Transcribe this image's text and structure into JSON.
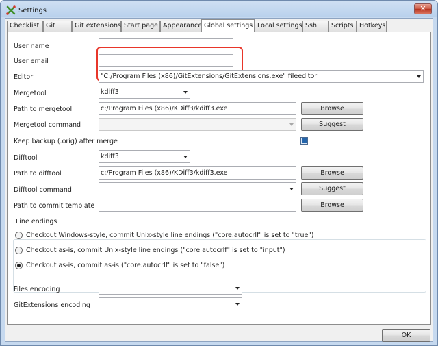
{
  "window": {
    "title": "Settings",
    "close_label": "✕"
  },
  "tabs": [
    {
      "label": "Checklist"
    },
    {
      "label": "Git"
    },
    {
      "label": "Git extensions"
    },
    {
      "label": "Start page"
    },
    {
      "label": "Appearance"
    },
    {
      "label": "Global settings"
    },
    {
      "label": "Local settings"
    },
    {
      "label": "Ssh"
    },
    {
      "label": "Scripts"
    },
    {
      "label": "Hotkeys"
    }
  ],
  "active_tab": "Global settings",
  "form": {
    "user_name": {
      "label": "User name",
      "value": ""
    },
    "user_email": {
      "label": "User email",
      "value": ""
    },
    "editor": {
      "label": "Editor",
      "value": "\"C:/Program Files (x86)/GitExtensions/GitExtensions.exe\" fileeditor"
    },
    "mergetool": {
      "label": "Mergetool",
      "value": "kdiff3"
    },
    "path_to_mergetool": {
      "label": "Path to mergetool",
      "value": "c:/Program Files (x86)/KDiff3/kdiff3.exe",
      "button": "Browse"
    },
    "mergetool_command": {
      "label": "Mergetool command",
      "value": "",
      "button": "Suggest"
    },
    "keep_backup": {
      "label": "Keep backup (.orig) after merge",
      "checked": true
    },
    "difftool": {
      "label": "Difftool",
      "value": "kdiff3"
    },
    "path_to_difftool": {
      "label": "Path to difftool",
      "value": "c:/Program Files (x86)/KDiff3/kdiff3.exe",
      "button": "Browse"
    },
    "difftool_command": {
      "label": "Difftool command",
      "value": "",
      "button": "Suggest"
    },
    "path_to_commit_template": {
      "label": "Path to commit template",
      "value": "",
      "button": "Browse"
    }
  },
  "line_endings": {
    "title": "Line endings",
    "options": [
      {
        "label": "Checkout Windows-style, commit Unix-style line endings (\"core.autocrlf\"  is set to \"true\")",
        "selected": false
      },
      {
        "label": "Checkout as-is, commit Unix-style line endings (\"core.autocrlf\"  is set to \"input\")",
        "selected": false
      },
      {
        "label": "Checkout as-is, commit as-is (\"core.autocrlf\"  is set to \"false\")",
        "selected": true
      }
    ]
  },
  "encoding": {
    "files": {
      "label": "Files encoding",
      "value": ""
    },
    "gitextensions": {
      "label": "GitExtensions encoding",
      "value": ""
    }
  },
  "footer": {
    "ok_label": "OK"
  },
  "colors": {
    "highlight": "#e8362a",
    "accent": "#2465ab"
  }
}
